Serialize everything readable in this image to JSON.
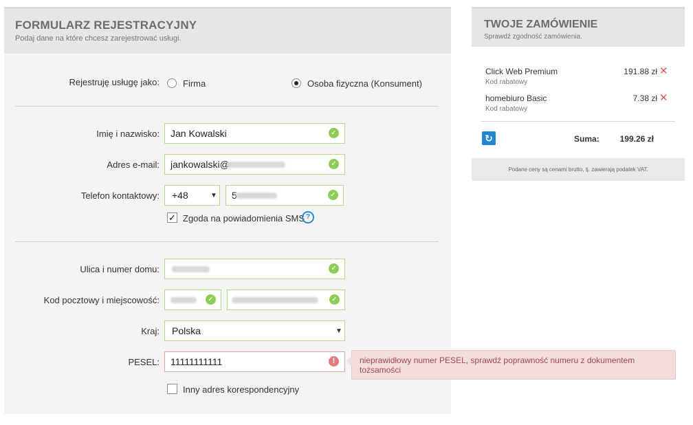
{
  "form": {
    "title": "FORMULARZ REJESTRACYJNY",
    "subtitle": "Podaj dane na które chcesz zarejestrować usługi.",
    "register_as_label": "Rejestruję usługę jako:",
    "option_firma": "Firma",
    "option_osoba": "Osoba fizyczna (Konsument)",
    "selected_option": "osoba",
    "name_label": "Imię i nazwisko:",
    "name_value": "Jan Kowalski",
    "email_label": "Adres e-mail:",
    "email_value": "jankowalski@",
    "phone_label": "Telefon kontaktowy:",
    "phone_prefix": "+48",
    "phone_value_start": "5",
    "sms_label": "Zgoda na powiadomienia SMS",
    "sms_checked": true,
    "street_label": "Ulica i numer domu:",
    "postal_label": "Kod pocztowy i miejscowość:",
    "country_label": "Kraj:",
    "country_value": "Polska",
    "pesel_label": "PESEL:",
    "pesel_value": "11111111111",
    "pesel_error": "nieprawidłowy numer PESEL, sprawdź poprawność numeru z dokumentem tożsamości",
    "alt_address_label": "Inny adres korespondencyjny",
    "alt_address_checked": false
  },
  "order": {
    "title": "TWOJE ZAMÓWIENIE",
    "subtitle": "Sprawdź zgodność zamówienia.",
    "items": [
      {
        "name": "Click Web Premium",
        "sub": "Kod rabatowy",
        "price": "191.88 zł"
      },
      {
        "name": "homebiuro Basic",
        "sub": "Kod rabatowy",
        "price": "7.38 zł"
      }
    ],
    "sum_label": "Suma:",
    "sum_value": "199.26 zł",
    "footer_note": "Podane ceny są cenami brutto, tj. zawierają podatek VAT."
  },
  "icons": {
    "ok": "check-circle-icon",
    "error": "exclamation-circle-icon",
    "help": "question-circle-icon",
    "remove": "close-icon",
    "refresh": "refresh-icon"
  },
  "colors": {
    "ok_green": "#8ecb58",
    "error_red": "#e27a7a",
    "accent_blue": "#1f87cf"
  }
}
